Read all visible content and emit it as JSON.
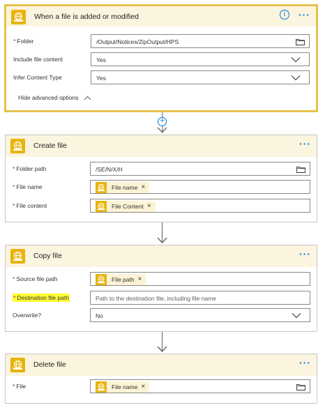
{
  "trigger": {
    "title": "When a file is added or modified",
    "info_glyph": "i",
    "more_glyph": "···",
    "fields": [
      {
        "label": "Folder",
        "required": true,
        "value": "/Output/Notices/ZipOutput/HPS"
      },
      {
        "label": "Include file content",
        "required": false,
        "value": "Yes"
      },
      {
        "label": "Infer Content Type",
        "required": false,
        "value": "Yes"
      }
    ],
    "advanced_label": "Hide advanced options"
  },
  "create_file": {
    "title": "Create file",
    "more_glyph": "···",
    "fields": [
      {
        "label": "Folder path",
        "required": true,
        "value": "/SE/N/X/H"
      },
      {
        "label": "File name",
        "required": true,
        "token": "File name"
      },
      {
        "label": "File content",
        "required": true,
        "token": "File Content"
      }
    ]
  },
  "copy_file": {
    "title": "Copy file",
    "more_glyph": "···",
    "fields": [
      {
        "label": "Source file path",
        "required": true,
        "token": "File path"
      },
      {
        "label": "Destination file path",
        "required": true,
        "placeholder": "Path to the destination file, including file name",
        "highlighted": true
      },
      {
        "label": "Overwrite?",
        "required": false,
        "value": "No"
      }
    ]
  },
  "delete_file": {
    "title": "Delete file",
    "more_glyph": "···",
    "fields": [
      {
        "label": "File",
        "required": true,
        "token": "File name"
      }
    ]
  },
  "glyphs": {
    "required_mark": "*",
    "remove": "×",
    "add_step": "+"
  },
  "colors": {
    "accent": "#0078d4",
    "connector_icon": "#e8b40c",
    "header_bg": "#fbf4df",
    "selected_border": "#e6c24a",
    "highlight": "#ffff33"
  }
}
